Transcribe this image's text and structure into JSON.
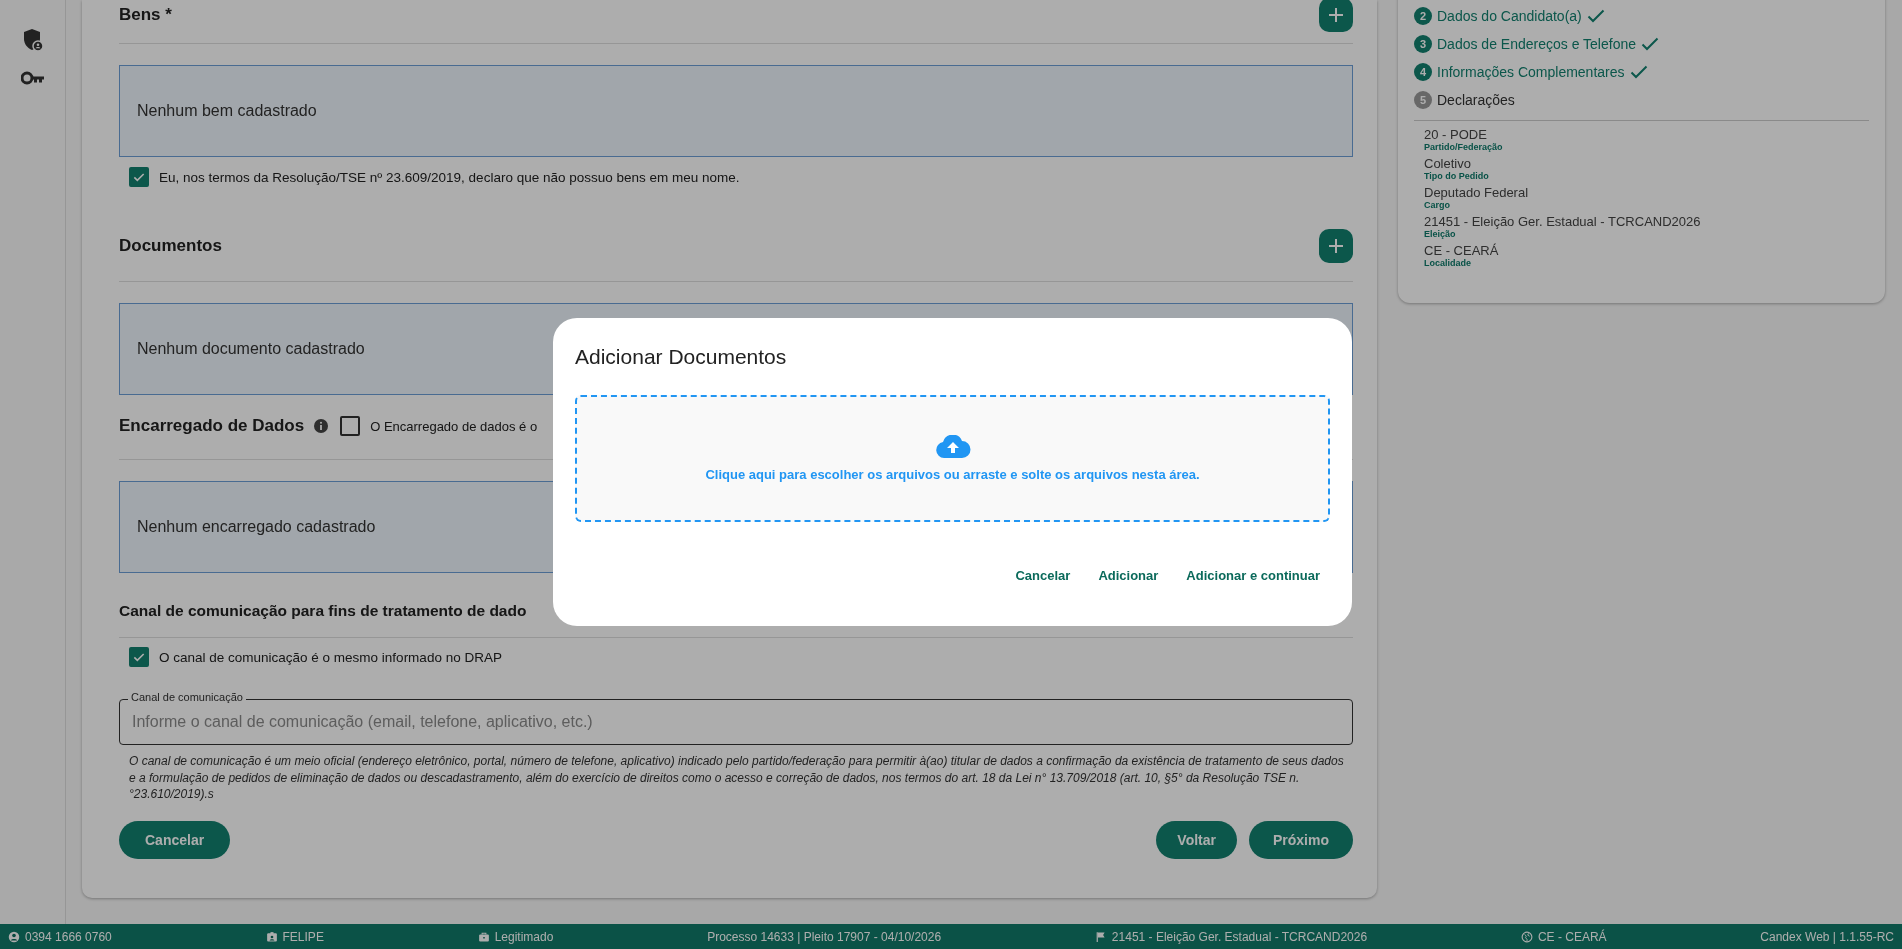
{
  "sections": [
    {
      "kind": "list",
      "title": "Bens *",
      "add_button": true,
      "empty_text": "Nenhum bem cadastrado",
      "declaration": {
        "checked": true,
        "text": "Eu, nos termos da Resolução/TSE nº 23.609/2019, declaro que não possuo bens em meu nome."
      }
    },
    {
      "kind": "list",
      "title": "Documentos",
      "add_button": true,
      "empty_text": "Nenhum documento cadastrado"
    },
    {
      "kind": "list",
      "title": "Encarregado de Dados",
      "info": true,
      "inline_check": {
        "checked": false,
        "text": "O Encarregado de dados é o"
      },
      "empty_text": "Nenhum encarregado cadastrado"
    },
    {
      "kind": "channel",
      "title": "Canal de comunicação para fins de tratamento de dado",
      "declaration": {
        "checked": true,
        "text": "O canal de comunicação é o mesmo informado no DRAP"
      },
      "field": {
        "label": "Canal de comunicação",
        "placeholder": "Informe o canal de comunicação (email, telefone, aplicativo, etc.)"
      },
      "note": "O canal de comunicação é um meio oficial (endereço eletrônico, portal, número de telefone, aplicativo) indicado pelo partido/federação para permitir à(ao) titular de dados a confirmação da existência de tratamento de seus dados e a formulação de pedidos de eliminação de dados ou descadastramento, além do exercício de direitos como o acesso e correção de dados, nos termos do art. 18 da Lei n° 13.709/2018 (art. 10, §5° da Resolução TSE n.°23.610/2019).s"
    }
  ],
  "footer_buttons": {
    "left": [
      "Cancelar"
    ],
    "right": [
      "Voltar",
      "Próximo"
    ]
  },
  "steps": [
    {
      "number": "2",
      "label": "Dados do Candidato(a)",
      "done": true
    },
    {
      "number": "3",
      "label": "Dados de Endereços e Telefone",
      "done": true
    },
    {
      "number": "4",
      "label": "Informações Complementares",
      "done": true
    },
    {
      "number": "5",
      "label": "Declarações",
      "done": false
    }
  ],
  "summary": [
    {
      "value": "20 - PODE",
      "caption": "Partido/Federação"
    },
    {
      "value": "Coletivo",
      "caption": "Tipo do Pedido"
    },
    {
      "value": "Deputado Federal",
      "caption": "Cargo"
    },
    {
      "value": "21451 - Eleição Ger. Estadual - TCRCAND2026",
      "caption": "Eleição"
    },
    {
      "value": "CE - CEARÁ",
      "caption": "Localidade"
    }
  ],
  "dialog": {
    "title": "Adicionar Documentos",
    "dropzone_text": "Clique aqui para escolher os arquivos ou arraste e solte os arquivos nesta área.",
    "buttons": [
      "Cancelar",
      "Adicionar",
      "Adicionar e continuar"
    ]
  },
  "status_bar": [
    "0394 1666 0760",
    "FELIPE",
    "Legitimado",
    "Processo 14633 | Pleito 17907 - 04/10/2026",
    "21451 - Eleição Ger. Estadual - TCRCAND2026",
    "CE - CEARÁ",
    "Candex Web | 1.1.55-RC"
  ]
}
